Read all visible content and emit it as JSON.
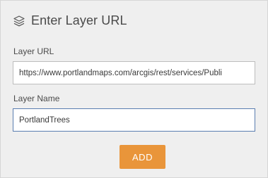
{
  "panel": {
    "title": "Enter Layer URL",
    "icon": "layers-icon"
  },
  "form": {
    "url_label": "Layer URL",
    "url_value": "https://www.portlandmaps.com/arcgis/rest/services/Publi",
    "name_label": "Layer Name",
    "name_value": "PortlandTrees"
  },
  "actions": {
    "add_label": "ADD"
  },
  "colors": {
    "accent": "#e9953a",
    "focus_border": "#5a7db0"
  }
}
